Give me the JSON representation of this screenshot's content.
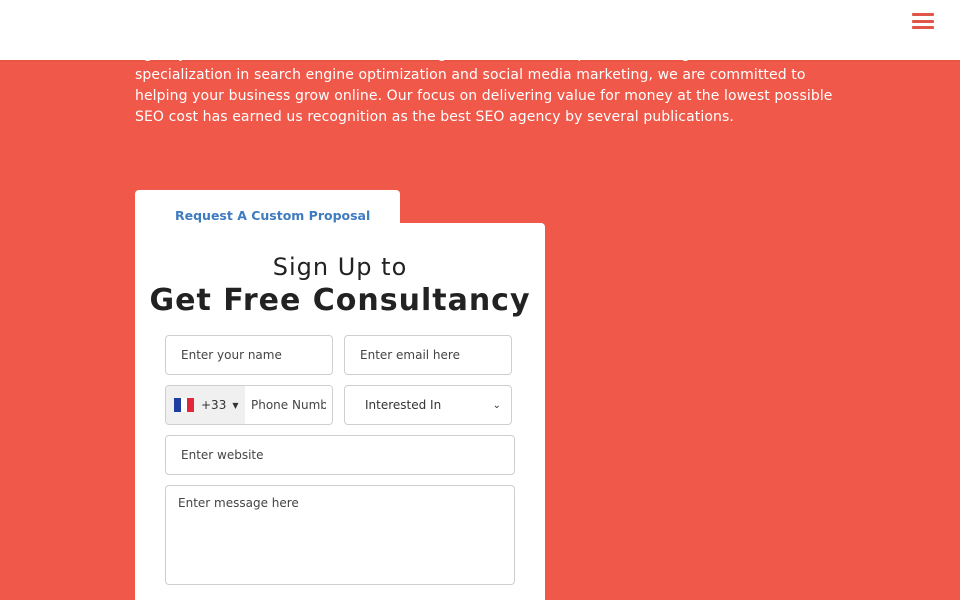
{
  "intro": {
    "paragraph": "agency, we offer various services, including SEO, SMM, and reputation management. With our specialization in search engine optimization and social media marketing, we are committed to helping your business grow online. Our focus on delivering value for money at the lowest possible SEO cost has earned us recognition as the best SEO agency by several publications."
  },
  "form": {
    "tab_label": "Request A Custom Proposal",
    "title_line1": "Sign Up to",
    "title_line2": "Get Free Consultancy",
    "name_placeholder": "Enter your name",
    "email_placeholder": "Enter email here",
    "phone": {
      "dial_code": "+33",
      "flag_icon": "france-flag-icon",
      "placeholder": "Phone Number"
    },
    "interest_selected": "Interested In",
    "website_placeholder": "Enter website",
    "message_placeholder": "Enter message here"
  },
  "colors": {
    "background": "#f0584a",
    "tab_text": "#3f7bbf",
    "menu_icon": "#e0574a"
  }
}
